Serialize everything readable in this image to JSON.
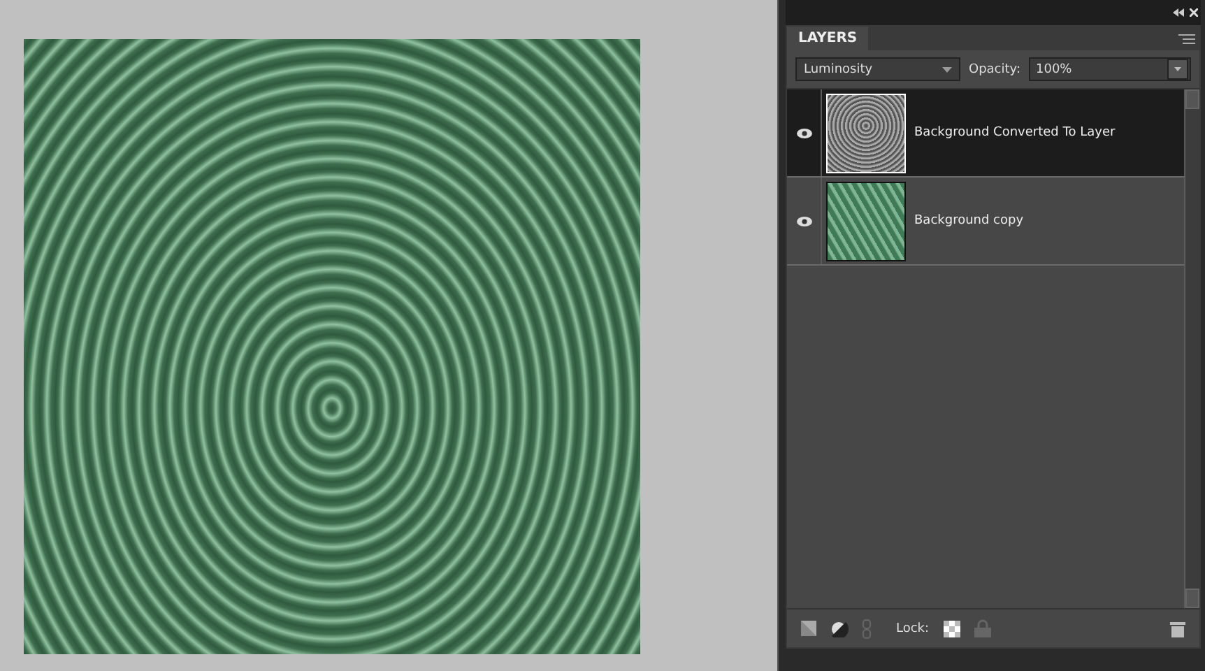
{
  "panel": {
    "tab": "LAYERS",
    "blend_mode": "Luminosity",
    "opacity_label": "Opacity:",
    "opacity": "100%",
    "layers": [
      {
        "name": "Background Converted To Layer",
        "selected": true,
        "visible": true,
        "kind": "gray"
      },
      {
        "name": "Background copy",
        "selected": false,
        "visible": true,
        "kind": "green"
      }
    ],
    "lock_label": "Lock:"
  }
}
